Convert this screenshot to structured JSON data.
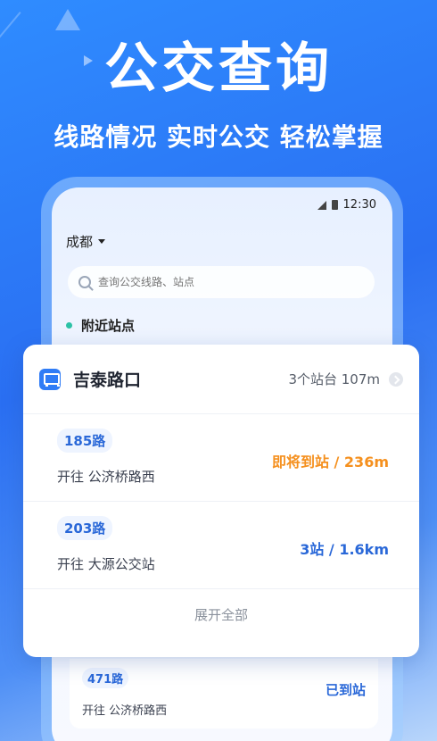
{
  "promo": {
    "headline": "公交查询",
    "subline": "线路情况 实时公交 轻松掌握"
  },
  "status_bar": {
    "time": "12:30"
  },
  "city_selector": {
    "city": "成都"
  },
  "search": {
    "placeholder": "查询公交线路、站点"
  },
  "nearby": {
    "label": "附近站点"
  },
  "stop_card": {
    "stop_name": "吉泰路口",
    "meta": "3个站台 107m",
    "routes": [
      {
        "route": "185路",
        "dest": "开往 公济桥路西",
        "status": "即将到站 / 236m",
        "status_color": "#f5901e"
      },
      {
        "route": "203路",
        "dest": "开往 大源公交站",
        "status": "3站 / 1.6km",
        "status_color": "#2a68d8"
      }
    ],
    "expand_label": "展开全部"
  },
  "background_card": {
    "route": "471路",
    "dest": "开往 公济桥路西",
    "status": "已到站",
    "status_color": "#2a68d8"
  },
  "colors": {
    "accent": "#2f7cf6",
    "arriving": "#f5901e",
    "teal_dot": "#2cc2a6"
  }
}
